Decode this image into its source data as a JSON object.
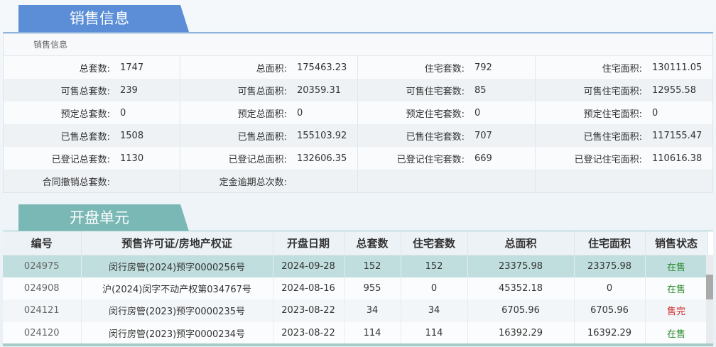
{
  "sales_section": {
    "title": "销售信息",
    "caption": "销售信息",
    "columns": [
      [
        {
          "label": "总套数:",
          "value": "1747"
        },
        {
          "label": "可售总套数:",
          "value": "239"
        },
        {
          "label": "预定总套数:",
          "value": "0"
        },
        {
          "label": "已售总套数:",
          "value": "1508"
        },
        {
          "label": "已登记总套数:",
          "value": "1130"
        },
        {
          "label": "合同撤销总套数:",
          "value": ""
        }
      ],
      [
        {
          "label": "总面积:",
          "value": "175463.23"
        },
        {
          "label": "可售总面积:",
          "value": "20359.31"
        },
        {
          "label": "预定总面积:",
          "value": "0"
        },
        {
          "label": "已售总面积:",
          "value": "155103.92"
        },
        {
          "label": "已登记总面积:",
          "value": "132606.35"
        },
        {
          "label": "定金逾期总次数:",
          "value": ""
        }
      ],
      [
        {
          "label": "住宅套数:",
          "value": "792"
        },
        {
          "label": "可售住宅套数:",
          "value": "85"
        },
        {
          "label": "预定住宅套数:",
          "value": "0"
        },
        {
          "label": "已售住宅套数:",
          "value": "707"
        },
        {
          "label": "已登记住宅套数:",
          "value": "669"
        },
        {
          "label": "",
          "value": ""
        }
      ],
      [
        {
          "label": "住宅面积:",
          "value": "130111.05"
        },
        {
          "label": "可售住宅面积:",
          "value": "12955.58"
        },
        {
          "label": "预定住宅面积:",
          "value": "0"
        },
        {
          "label": "已售住宅面积:",
          "value": "117155.47"
        },
        {
          "label": "已登记住宅面积:",
          "value": "110616.38"
        },
        {
          "label": "",
          "value": ""
        }
      ]
    ]
  },
  "units_section": {
    "title": "开盘单元",
    "headers": [
      "编号",
      "预售许可证/房地产权证",
      "开盘日期",
      "总套数",
      "住宅套数",
      "总面积",
      "住宅面积",
      "销售状态"
    ],
    "rows": [
      [
        "024975",
        "闵行房管(2024)预字0000256号",
        "2024-09-28",
        "152",
        "152",
        "23375.98",
        "23375.98",
        "在售"
      ],
      [
        "024908",
        "沪(2024)闵字不动产权第034767号",
        "2024-08-16",
        "955",
        "0",
        "45352.18",
        "0",
        "在售"
      ],
      [
        "024121",
        "闵行房管(2023)预字0000235号",
        "2023-08-22",
        "34",
        "34",
        "6705.96",
        "6705.96",
        "售完"
      ],
      [
        "024120",
        "闵行房管(2023)预字0000234号",
        "2023-08-22",
        "114",
        "114",
        "16392.29",
        "16392.29",
        "在售"
      ]
    ],
    "status_colors": {
      "在售": "#2b8a2b",
      "售完": "#d12a2a"
    }
  }
}
